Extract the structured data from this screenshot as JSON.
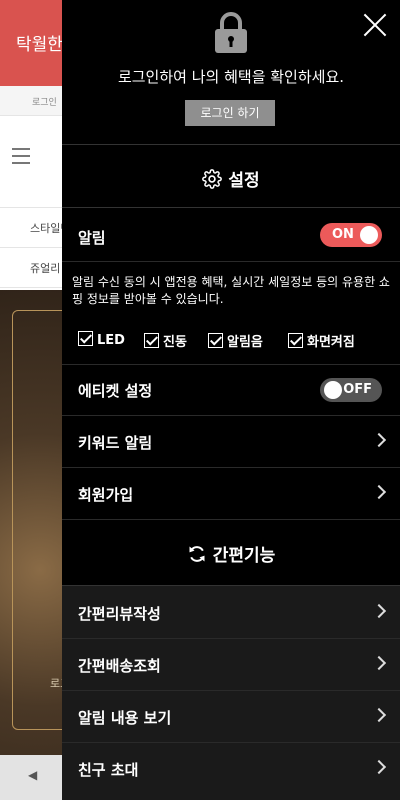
{
  "background": {
    "header_title": "탁월한",
    "subbar_text": "로그인",
    "list_items": [
      "스타일밴",
      "쥬얼리"
    ],
    "banner_text": "로그",
    "bottom_arrow": "◀"
  },
  "drawer": {
    "login": {
      "message": "로그인하여 나의 혜택을 확인하세요.",
      "button": "로그인 하기"
    },
    "settings": {
      "title": "설정",
      "notification": {
        "label": "알림",
        "toggle": "ON",
        "state": true,
        "description": "알림 수신 동의 시 앱전용 혜택, 실시간 세일정보 등의 유용한 쇼핑 정보를 받아볼 수 있습니다.",
        "options": [
          {
            "label": "LED",
            "checked": true
          },
          {
            "label": "진동",
            "checked": true
          },
          {
            "label": "알림음",
            "checked": true
          },
          {
            "label": "화면켜짐",
            "checked": true
          }
        ]
      },
      "etiquette": {
        "label": "에티켓 설정",
        "toggle": "OFF",
        "state": false
      },
      "keyword_alert": "키워드 알림",
      "signup": "회원가입"
    },
    "quick": {
      "title": "간편기능",
      "items": [
        "간편리뷰작성",
        "간편배송조회",
        "알림 내용 보기",
        "친구 초대"
      ]
    }
  },
  "colors": {
    "accent_on": "#ec5a5a",
    "header_red": "#d9534f",
    "drawer_bg": "#000000"
  }
}
